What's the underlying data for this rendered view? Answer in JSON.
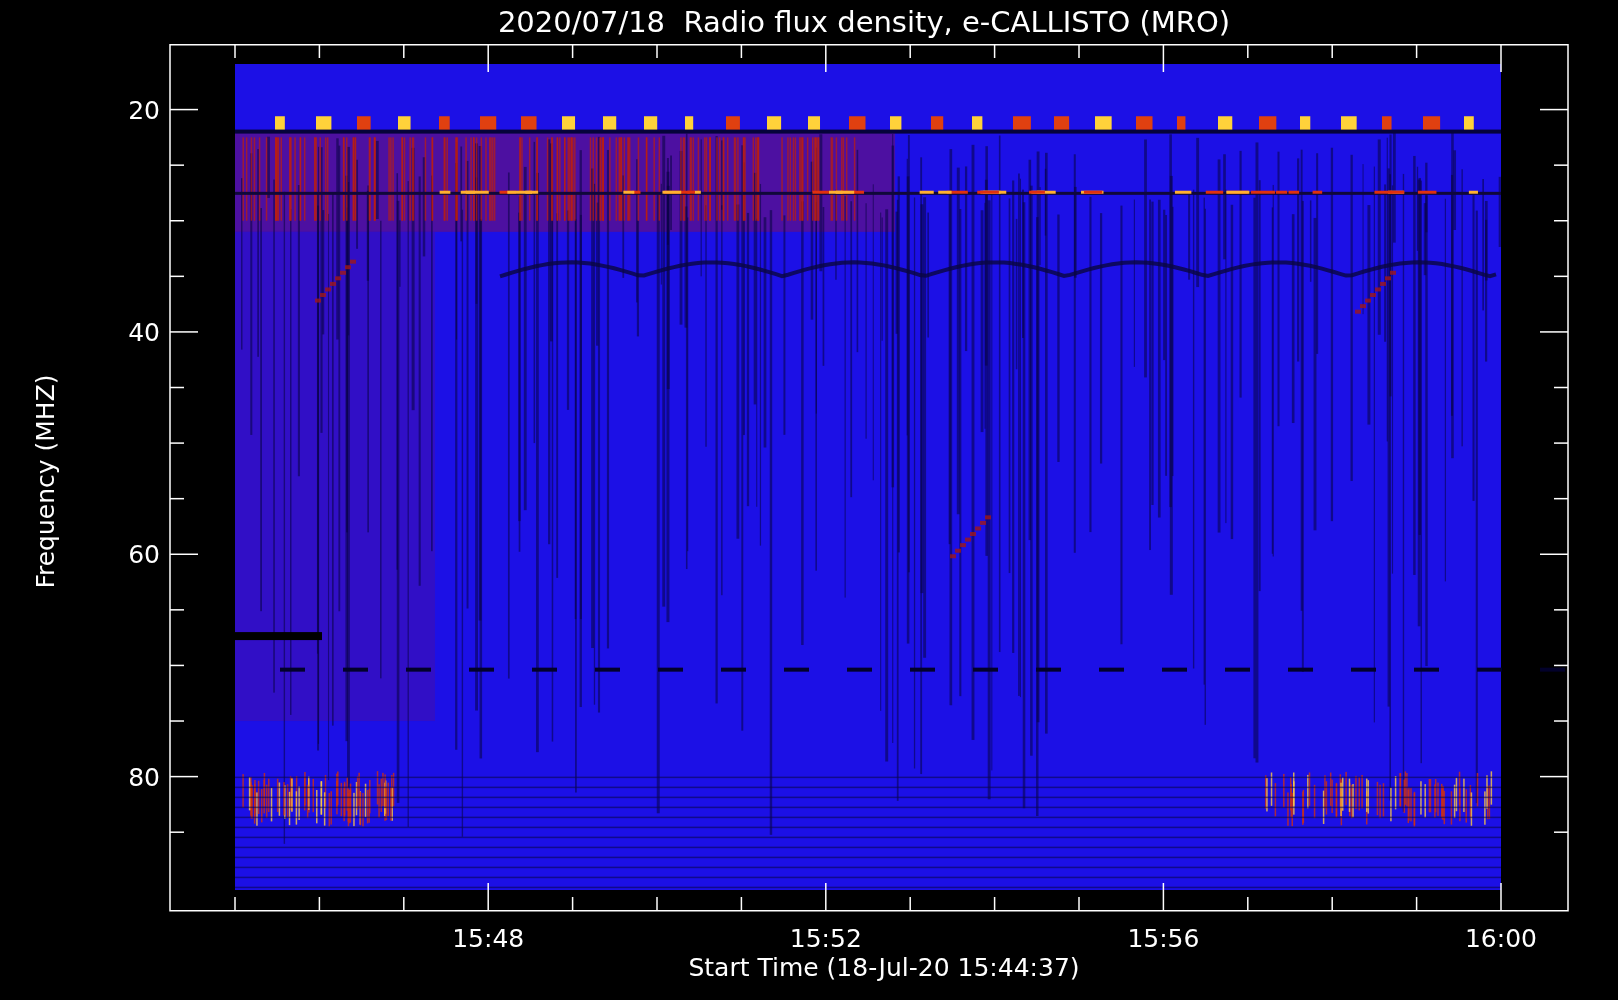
{
  "title": "2020/07/18  Radio flux density, e-CALLISTO (MRO)",
  "y_axis": {
    "label": "Frequency (MHZ)",
    "ticks": [
      "20",
      "40",
      "60",
      "80"
    ]
  },
  "x_axis": {
    "label": "Start Time (18-Jul-20 15:44:37)",
    "ticks": [
      "15:48",
      "15:52",
      "15:56",
      "16:00"
    ]
  }
}
